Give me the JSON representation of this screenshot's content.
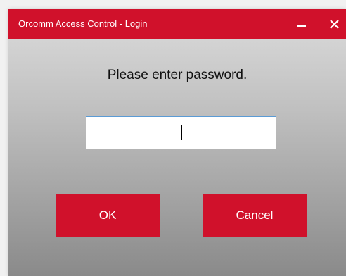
{
  "window": {
    "title": "Orcomm Access Control - Login",
    "controls": {
      "minimize_icon": "minimize-icon",
      "close_icon": "close-icon"
    }
  },
  "dialog": {
    "prompt": "Please enter password.",
    "password_field": {
      "value": "",
      "placeholder": ""
    },
    "buttons": {
      "ok_label": "OK",
      "cancel_label": "Cancel"
    }
  },
  "colors": {
    "accent": "#d0112b",
    "input_border": "#5b9bd5"
  }
}
